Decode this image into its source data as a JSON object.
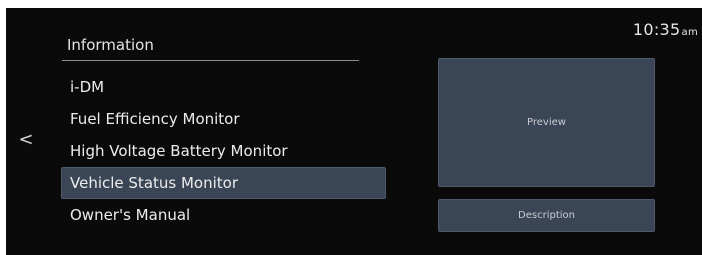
{
  "header": {
    "time": "10:35",
    "ampm": "am"
  },
  "navigation": {
    "back_icon": "<"
  },
  "menu": {
    "title": "Information",
    "items": [
      {
        "label": "i-DM",
        "selected": false
      },
      {
        "label": "Fuel Efficiency Monitor",
        "selected": false
      },
      {
        "label": "High Voltage Battery Monitor",
        "selected": false
      },
      {
        "label": "Vehicle Status Monitor",
        "selected": true
      },
      {
        "label": "Owner's Manual",
        "selected": false
      }
    ]
  },
  "panel": {
    "preview_label": "Preview",
    "description_label": "Description"
  },
  "colors": {
    "background": "#0a0a0a",
    "highlight": "#3a4556",
    "text": "#ececec"
  }
}
